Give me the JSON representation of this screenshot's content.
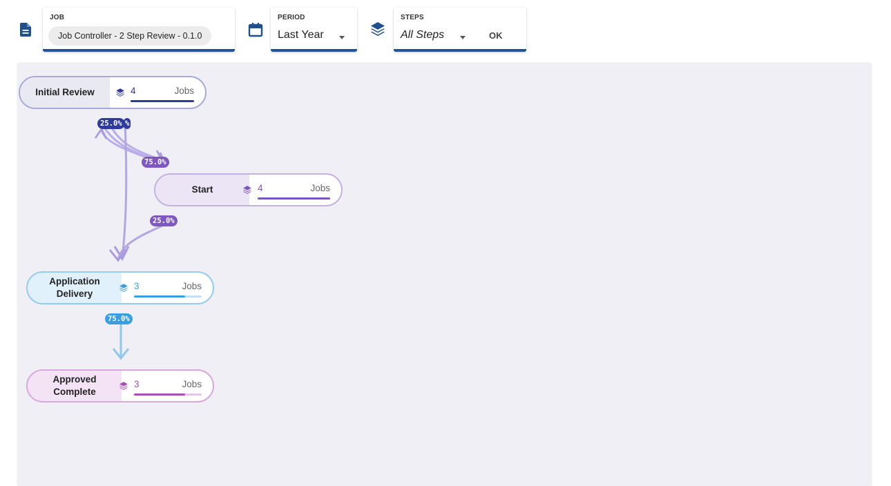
{
  "toolbar": {
    "job": {
      "label": "JOB",
      "value": "Job Controller - 2 Step Review - 0.1.0",
      "icon": "document-icon"
    },
    "period": {
      "label": "PERIOD",
      "value": "Last Year",
      "icon": "calendar-icon"
    },
    "steps": {
      "label": "STEPS",
      "value": "All Steps",
      "ok_label": "OK",
      "icon": "layers-icon"
    },
    "accent": "#1f5597"
  },
  "workflow": {
    "nodes": [
      {
        "id": "initial-review",
        "title": "Initial Review",
        "count": "4",
        "unit": "Jobs",
        "color": "#2f3a9e",
        "fill": 1.0
      },
      {
        "id": "start",
        "title": "Start",
        "count": "4",
        "unit": "Jobs",
        "color": "#7b54bd",
        "fill": 1.0
      },
      {
        "id": "application-delivery",
        "title": "Application Delivery",
        "count": "3",
        "unit": "Jobs",
        "color": "#3a9ee5",
        "fill": 0.75
      },
      {
        "id": "approved-complete",
        "title": "Approved Complete",
        "count": "3",
        "unit": "Jobs",
        "color": "#a64db8",
        "fill": 0.75
      }
    ],
    "edges": [
      {
        "from": "initial-review",
        "to": "start",
        "label": "75.0%"
      },
      {
        "from": "initial-review",
        "to": "application-delivery",
        "label": "25.0%"
      },
      {
        "from": "start",
        "to": "initial-review",
        "label": "%"
      },
      {
        "from": "start",
        "to": "application-delivery",
        "label": "25.0%"
      },
      {
        "from": "application-delivery",
        "to": "approved-complete",
        "label": "75.0%"
      }
    ]
  }
}
